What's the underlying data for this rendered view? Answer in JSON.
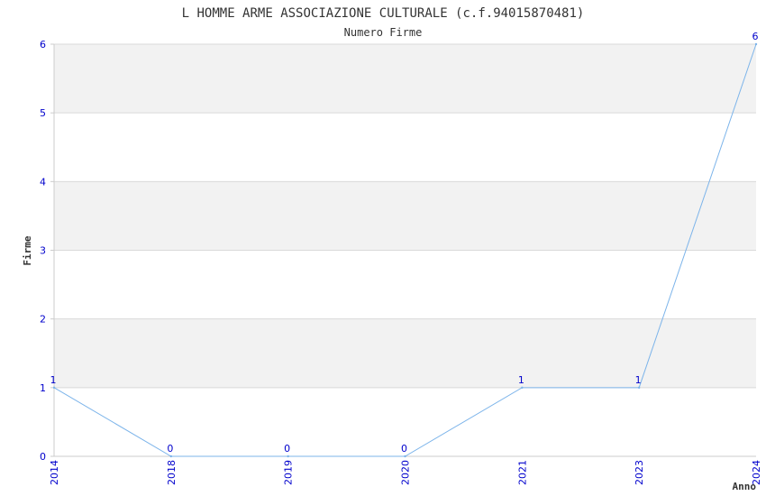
{
  "chart_data": {
    "type": "line",
    "title": "L HOMME ARME ASSOCIAZIONE CULTURALE (c.f.94015870481)",
    "subtitle": "Numero Firme",
    "xlabel": "Anno",
    "ylabel": "Firme",
    "categories": [
      "2014",
      "2018",
      "2019",
      "2020",
      "2021",
      "2023",
      "2024"
    ],
    "series": [
      {
        "values": [
          1,
          0,
          0,
          0,
          1,
          1,
          6
        ]
      }
    ],
    "ylim": [
      0,
      6
    ],
    "yticks": [
      "0",
      "1",
      "2",
      "3",
      "4",
      "5",
      "6"
    ],
    "grid": true,
    "colors": {
      "line": "#7cb4ea",
      "tick_text": "#0000cc",
      "band": "#f2f2f2",
      "grid": "#d9d9d9",
      "title": "#333333"
    }
  }
}
